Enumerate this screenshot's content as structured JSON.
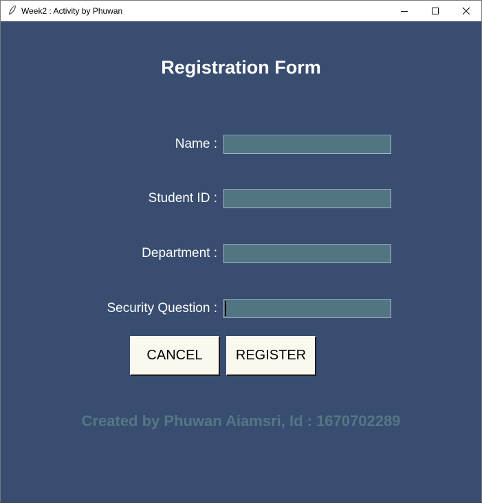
{
  "window": {
    "title": "Week2 : Activity by Phuwan",
    "icon": "feather-icon",
    "controls": {
      "minimize": "minimize-icon",
      "maximize": "maximize-icon",
      "close": "close-icon"
    }
  },
  "form": {
    "heading": "Registration Form",
    "fields": [
      {
        "label": "Name :",
        "value": ""
      },
      {
        "label": "Student ID :",
        "value": ""
      },
      {
        "label": "Department :",
        "value": ""
      },
      {
        "label": "Security Question :",
        "value": ""
      }
    ],
    "buttons": {
      "cancel": "CANCEL",
      "register": "REGISTER"
    },
    "footer": "Created by Phuwan Aiamsri, Id : 1670702289"
  },
  "colors": {
    "background": "#384d70",
    "input_background": "#527583",
    "button_background": "#fbf8ee",
    "footer_text": "#547785",
    "label_text": "#ffffff"
  }
}
